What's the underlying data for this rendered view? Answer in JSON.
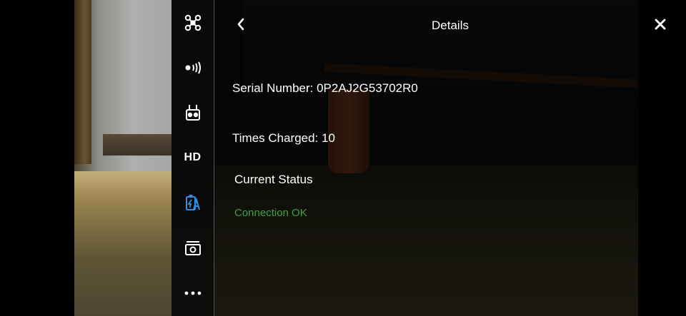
{
  "header": {
    "title": "Details",
    "back_icon": "chevron-left-icon",
    "close_icon": "close-icon"
  },
  "toolbar": {
    "items": [
      {
        "name": "aircraft",
        "icon": "drone-icon"
      },
      {
        "name": "signal",
        "icon": "signal-broadcast-icon"
      },
      {
        "name": "remote-controller",
        "icon": "remote-controller-icon"
      },
      {
        "name": "video-transmission",
        "label": "HD"
      },
      {
        "name": "battery",
        "icon": "battery-lightning-icon",
        "active": true
      },
      {
        "name": "camera",
        "icon": "camera-icon"
      },
      {
        "name": "more",
        "icon": "more-dots-icon"
      }
    ],
    "active_color": "#2f8fe0"
  },
  "details": {
    "serial_number": "Serial Number: 0P2AJ2G53702R0",
    "times_charged": "Times Charged: 10",
    "current_status_label": "Current Status",
    "current_status_value": "Connection OK",
    "status_color": "#3aa23c"
  }
}
